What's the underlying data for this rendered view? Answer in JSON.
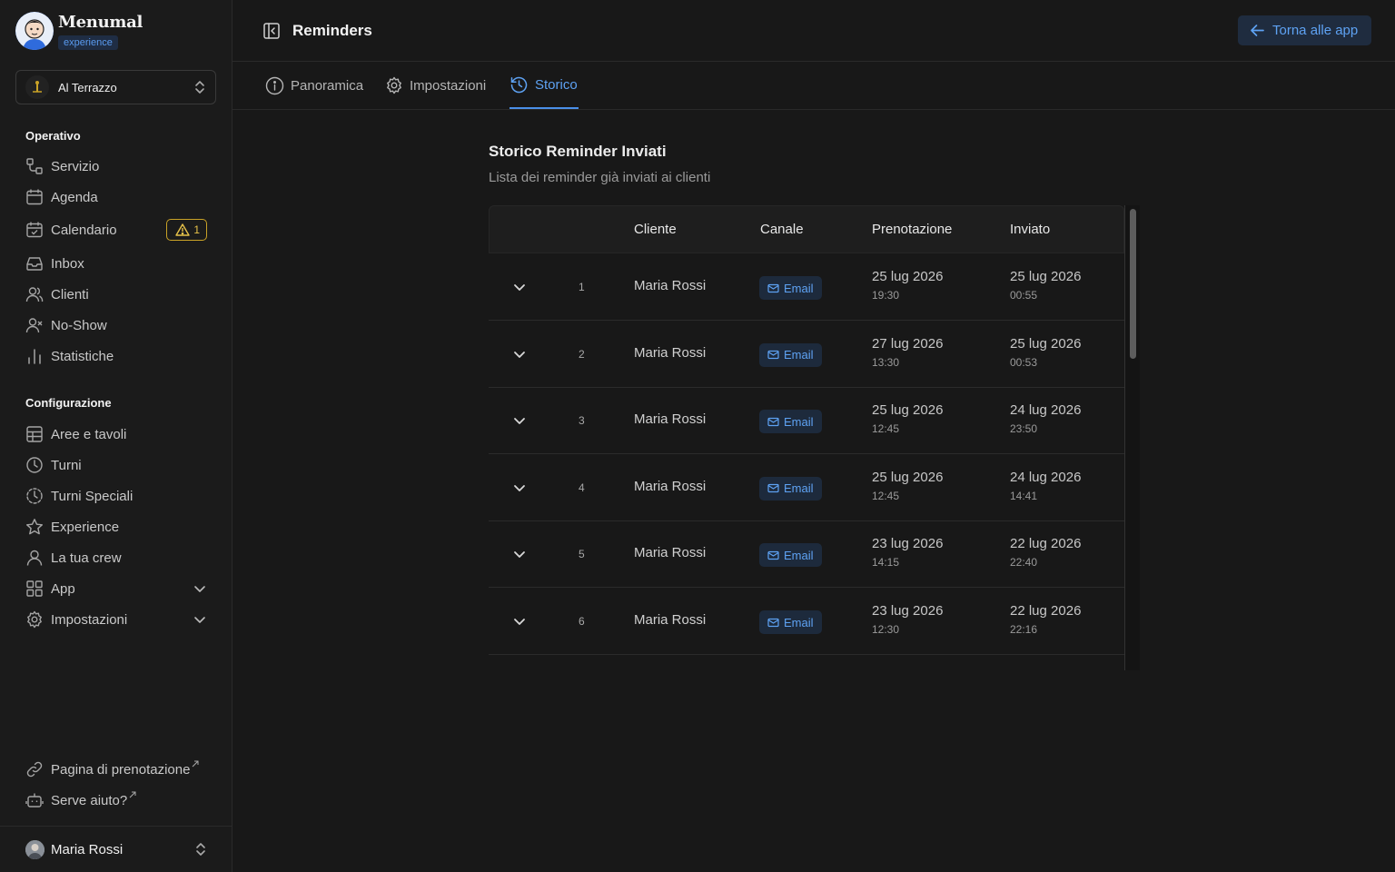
{
  "brand": {
    "name": "Menumal",
    "tag": "experience"
  },
  "venue": {
    "name": "Al Terrazzo"
  },
  "sidebar": {
    "operativo_title": "Operativo",
    "operativo": [
      {
        "label": "Servizio",
        "icon": "service-icon"
      },
      {
        "label": "Agenda",
        "icon": "calendar-icon"
      },
      {
        "label": "Calendario",
        "icon": "calendar-check-icon",
        "badge": "1"
      },
      {
        "label": "Inbox",
        "icon": "inbox-icon"
      },
      {
        "label": "Clienti",
        "icon": "users-icon"
      },
      {
        "label": "No-Show",
        "icon": "user-x-icon"
      },
      {
        "label": "Statistiche",
        "icon": "chart-icon"
      }
    ],
    "config_title": "Configurazione",
    "config": [
      {
        "label": "Aree e tavoli",
        "icon": "grid-icon"
      },
      {
        "label": "Turni",
        "icon": "clock-icon"
      },
      {
        "label": "Turni Speciali",
        "icon": "clock-dashed-icon"
      },
      {
        "label": "Experience",
        "icon": "star-icon"
      },
      {
        "label": "La tua crew",
        "icon": "user-icon"
      },
      {
        "label": "App",
        "icon": "apps-icon"
      },
      {
        "label": "Impostazioni",
        "icon": "gear-icon"
      }
    ],
    "booking_page": "Pagina di prenotazione",
    "help": "Serve aiuto?",
    "user": "Maria Rossi"
  },
  "header": {
    "title": "Reminders",
    "back_label": "Torna alle app"
  },
  "tabs": [
    {
      "label": "Panoramica"
    },
    {
      "label": "Impostazioni"
    },
    {
      "label": "Storico",
      "active": true
    }
  ],
  "history": {
    "title": "Storico Reminder Inviati",
    "subtitle": "Lista dei reminder già inviati ai clienti",
    "columns": [
      "Cliente",
      "Canale",
      "Prenotazione",
      "Inviato"
    ],
    "rows": [
      {
        "n": "1",
        "client": "Maria Rossi",
        "channel": "Email",
        "booking_date": "25 lug 2026",
        "booking_time": "19:30",
        "sent_date": "25 lug 2026",
        "sent_time": "00:55"
      },
      {
        "n": "2",
        "client": "Maria Rossi",
        "channel": "Email",
        "booking_date": "27 lug 2026",
        "booking_time": "13:30",
        "sent_date": "25 lug 2026",
        "sent_time": "00:53"
      },
      {
        "n": "3",
        "client": "Maria Rossi",
        "channel": "Email",
        "booking_date": "25 lug 2026",
        "booking_time": "12:45",
        "sent_date": "24 lug 2026",
        "sent_time": "23:50"
      },
      {
        "n": "4",
        "client": "Maria Rossi",
        "channel": "Email",
        "booking_date": "25 lug 2026",
        "booking_time": "12:45",
        "sent_date": "24 lug 2026",
        "sent_time": "14:41"
      },
      {
        "n": "5",
        "client": "Maria Rossi",
        "channel": "Email",
        "booking_date": "23 lug 2026",
        "booking_time": "14:15",
        "sent_date": "22 lug 2026",
        "sent_time": "22:40"
      },
      {
        "n": "6",
        "client": "Maria Rossi",
        "channel": "Email",
        "booking_date": "23 lug 2026",
        "booking_time": "12:30",
        "sent_date": "22 lug 2026",
        "sent_time": "22:16"
      }
    ]
  },
  "colors": {
    "accent": "#5ea2f3",
    "warning": "#e8c34a",
    "background": "#181818"
  }
}
